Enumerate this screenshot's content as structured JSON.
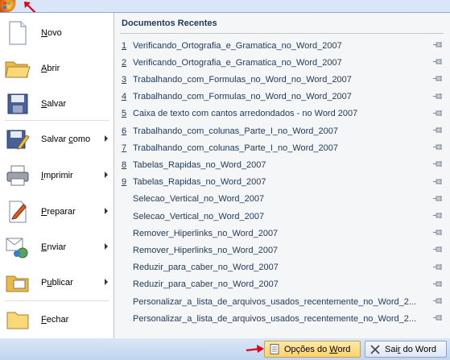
{
  "left_menu": {
    "items": [
      {
        "id": "novo",
        "label": "Novo",
        "underline": "N",
        "rest": "ovo",
        "has_submenu": false
      },
      {
        "id": "abrir",
        "label": "Abrir",
        "underline": "A",
        "rest": "brir",
        "has_submenu": false
      },
      {
        "id": "salvar",
        "label": "Salvar",
        "underline": "S",
        "rest": "alvar",
        "has_submenu": false
      },
      {
        "id": "salvar-como",
        "label": "Salvar como",
        "underline": "c",
        "pre": "Salvar ",
        "rest": "omo",
        "has_submenu": true
      },
      {
        "id": "imprimir",
        "label": "Imprimir",
        "underline": "I",
        "rest": "mprimir",
        "has_submenu": true
      },
      {
        "id": "preparar",
        "label": "Preparar",
        "underline": "P",
        "rest": "reparar",
        "has_submenu": true
      },
      {
        "id": "enviar",
        "label": "Enviar",
        "underline": "E",
        "rest": "nviar",
        "has_submenu": true
      },
      {
        "id": "publicar",
        "label": "Publicar",
        "underline": "u",
        "pre": "P",
        "rest": "blicar",
        "has_submenu": true
      },
      {
        "id": "fechar",
        "label": "Fechar",
        "underline": "F",
        "rest": "echar",
        "has_submenu": false
      }
    ]
  },
  "recent": {
    "title": "Documentos Recentes",
    "documents": [
      {
        "num": "1",
        "name": "Verificando_Ortografia_e_Gramatica_no_Word_2007"
      },
      {
        "num": "2",
        "name": "Verificando_Ortografia_e_Gramatica_no_Word_2007"
      },
      {
        "num": "3",
        "name": "Trabalhando_com_Formulas_no_Word_no_Word_2007"
      },
      {
        "num": "4",
        "name": "Trabalhando_com_Formulas_no_Word_no_Word_2007"
      },
      {
        "num": "5",
        "name": "Caixa de texto com cantos arredondados - no Word 2007"
      },
      {
        "num": "6",
        "name": "Trabalhando_com_colunas_Parte_I_no_Word_2007"
      },
      {
        "num": "7",
        "name": "Trabalhando_com_colunas_Parte_I_no_Word_2007"
      },
      {
        "num": "8",
        "name": "Tabelas_Rapidas_no_Word_2007"
      },
      {
        "num": "9",
        "name": "Tabelas_Rapidas_no_Word_2007"
      },
      {
        "num": "",
        "name": "Selecao_Vertical_no_Word_2007"
      },
      {
        "num": "",
        "name": "Selecao_Vertical_no_Word_2007"
      },
      {
        "num": "",
        "name": "Remover_Hiperlinks_no_Word_2007"
      },
      {
        "num": "",
        "name": "Remover_Hiperlinks_no_Word_2007"
      },
      {
        "num": "",
        "name": "Reduzir_para_caber_no_Word_2007"
      },
      {
        "num": "",
        "name": "Reduzir_para_caber_no_Word_2007"
      },
      {
        "num": "",
        "name": "Personalizar_a_lista_de_arquivos_usados_recentemente_no_Word_2..."
      },
      {
        "num": "",
        "name": "Personalizar_a_lista_de_arquivos_usados_recentemente_no_Word_2..."
      }
    ]
  },
  "footer": {
    "options_pre": "Opções do ",
    "options_ul": "W",
    "options_rest": "ord",
    "exit_pre": "Sai",
    "exit_ul": "r",
    "exit_rest": " do Word"
  },
  "colors": {
    "accent": "#15428b",
    "annotation": "#e0001a"
  }
}
